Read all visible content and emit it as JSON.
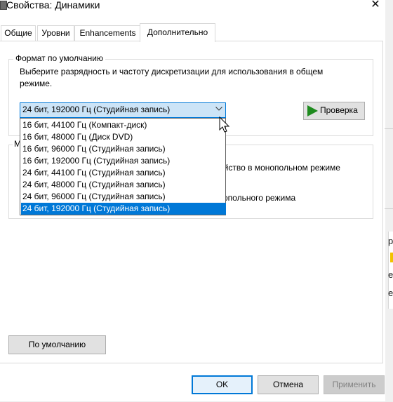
{
  "window": {
    "title": "Свойства: Динамики",
    "close_glyph": "✕"
  },
  "tabs": [
    {
      "label": "Общие"
    },
    {
      "label": "Уровни"
    },
    {
      "label": "Enhancements"
    },
    {
      "label": "Дополнительно",
      "active": true
    }
  ],
  "default_format": {
    "legend": "Формат по умолчанию",
    "description": "Выберите разрядность и частоту дискретизации для использования в общем режиме.",
    "selected": "24 бит, 192000 Гц (Студийная запись)",
    "options": [
      "16 бит, 44100 Гц (Компакт-диск)",
      "16 бит, 48000 Гц (Диск DVD)",
      "16 бит, 96000 Гц (Студийная запись)",
      "16 бит, 192000 Гц (Студийная запись)",
      "24 бит, 44100 Гц (Студийная запись)",
      "24 бит, 48000 Гц (Студийная запись)",
      "24 бит, 96000 Гц (Студийная запись)",
      "24 бит, 192000 Гц (Студийная запись)"
    ],
    "highlighted_index": 7,
    "test_button": "Проверка"
  },
  "exclusive_mode": {
    "legend_partial": "M",
    "line1_partial": "ойство в монопольном режиме",
    "line2_partial": "опольного режима"
  },
  "buttons": {
    "default": "По умолчанию",
    "ok": "OK",
    "cancel": "Отмена",
    "apply": "Применить"
  },
  "colors": {
    "accent": "#0078d7",
    "selection": "#0078d7",
    "combo_bg": "#cce4f7",
    "play_green": "#1f8b1f"
  },
  "background_window": {
    "glyphs": [
      "р",
      "е",
      "е"
    ]
  }
}
